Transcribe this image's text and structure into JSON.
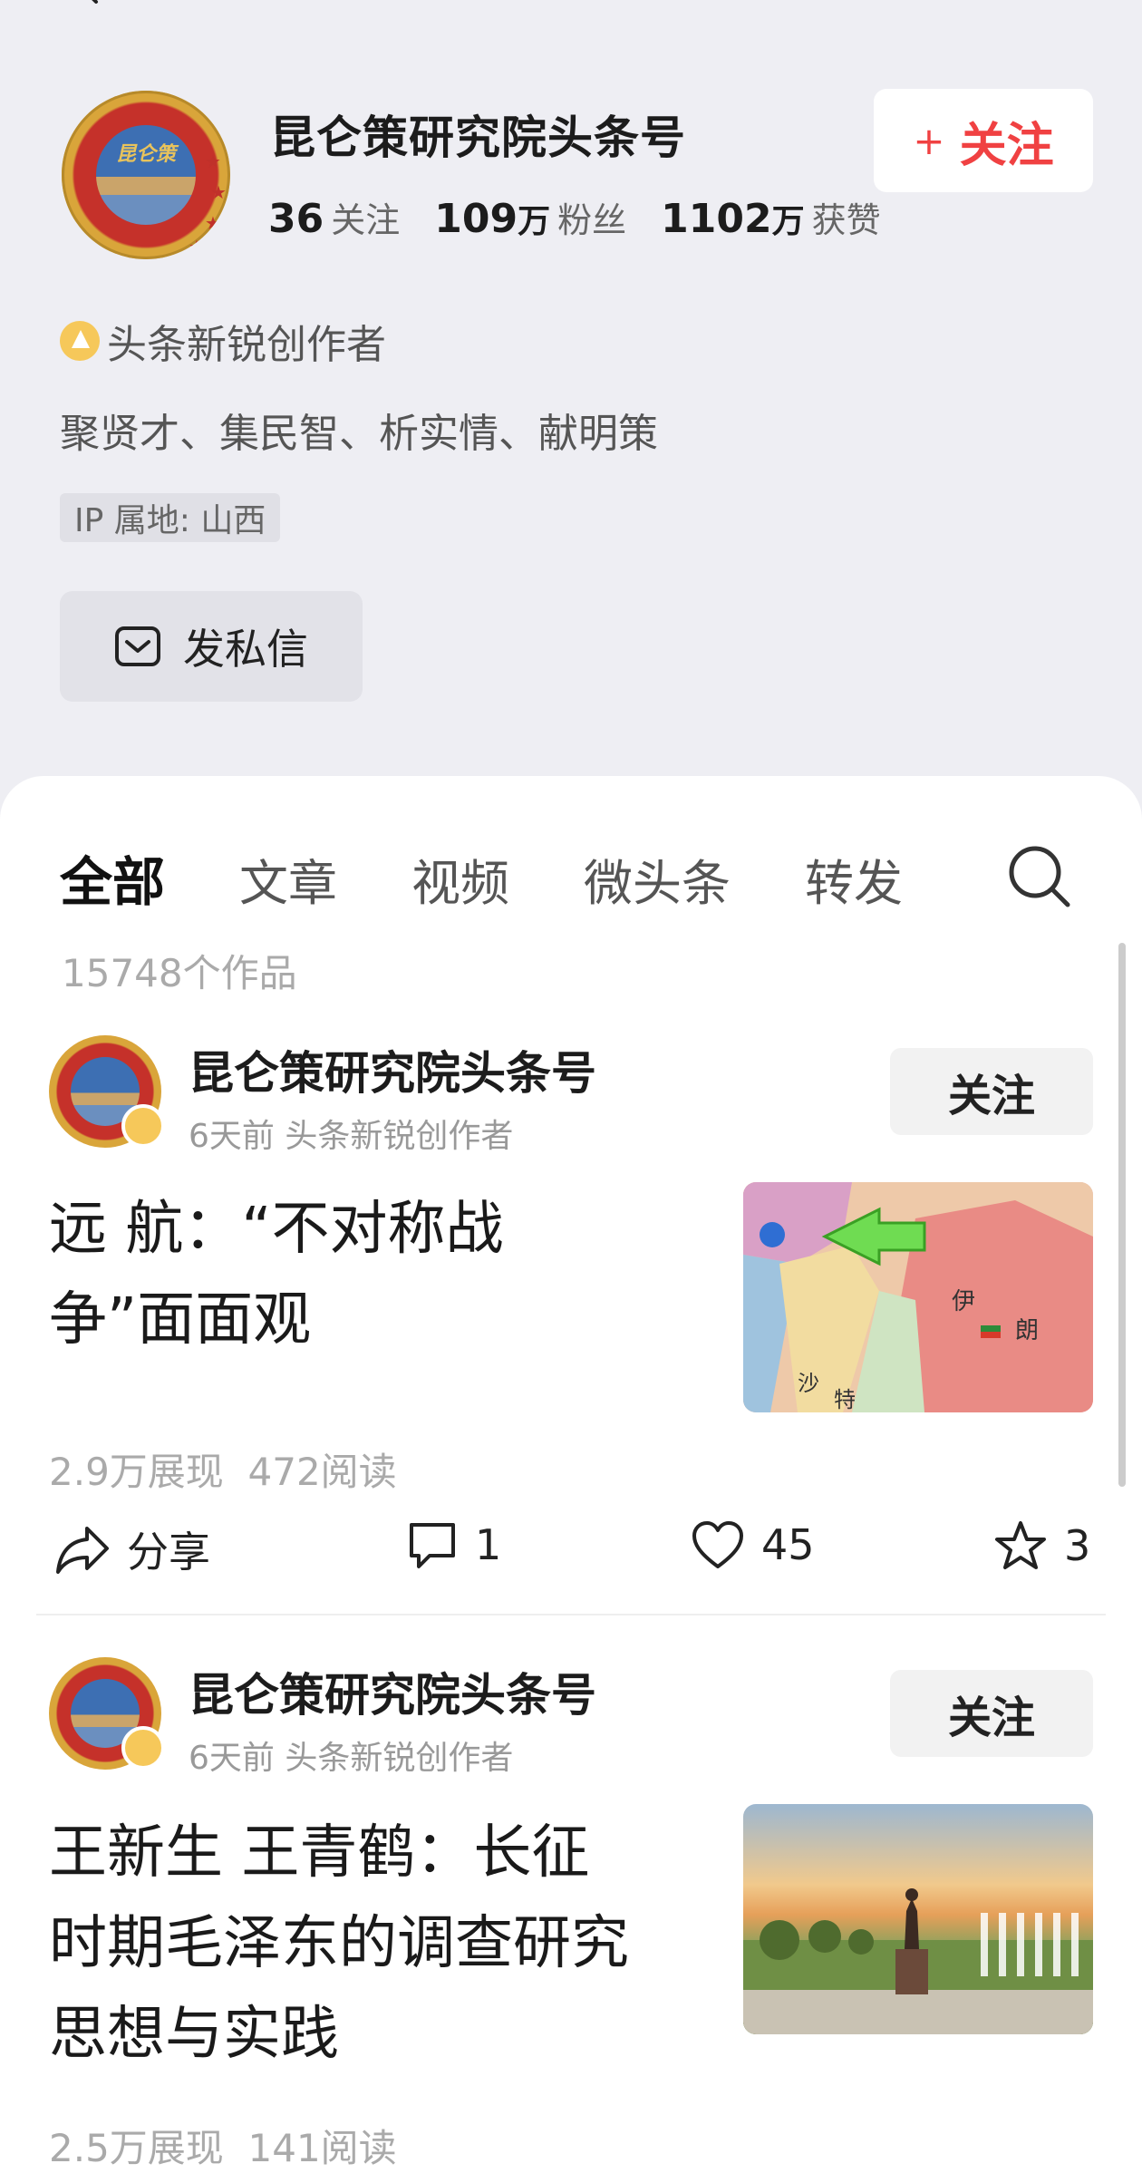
{
  "profile": {
    "name": "昆仑策研究院头条号",
    "logo_text": "昆仑策",
    "stats": [
      {
        "value": "36",
        "unit": "",
        "label": "关注"
      },
      {
        "value": "109",
        "unit": "万",
        "label": "粉丝"
      },
      {
        "value": "1102",
        "unit": "万",
        "label": "获赞"
      }
    ],
    "follow_label": "关注",
    "follow_plus": "+",
    "badge_text": "头条新锐创作者",
    "bio": "聚贤才、集民智、析实情、献明策",
    "ip_location": "IP 属地: 山西",
    "dm_label": "发私信"
  },
  "tabs": [
    "全部",
    "文章",
    "视频",
    "微头条",
    "转发"
  ],
  "works_count": "15748个作品",
  "posts": [
    {
      "author": "昆仑策研究院头条号",
      "meta": "6天前 头条新锐创作者",
      "follow_label": "关注",
      "title_lines": [
        "远 航：“不对称战",
        "争”面面观"
      ],
      "views": "2.9万展现",
      "reads": "472阅读",
      "share_label": "分享",
      "comments": "1",
      "likes": "45",
      "favorites": "3",
      "thumb_labels": [
        "伊",
        "朗",
        "沙",
        "特"
      ]
    },
    {
      "author": "昆仑策研究院头条号",
      "meta": "6天前 头条新锐创作者",
      "follow_label": "关注",
      "title_lines": [
        "王新生 王青鹤：长征",
        "时期毛泽东的调查研究",
        "思想与实践"
      ],
      "views": "2.5万展现",
      "reads": "141阅读"
    }
  ],
  "colors": {
    "accent": "#f04142",
    "badge": "#f6c85a",
    "background": "#eeeef3"
  }
}
